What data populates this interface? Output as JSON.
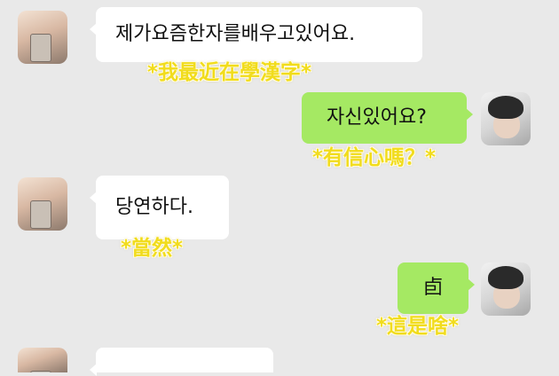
{
  "messages": [
    {
      "side": "in",
      "text": "제가요즘한자를배우고있어요.",
      "caption": "*我最近在學漢字*"
    },
    {
      "side": "out",
      "text": "자신있어요?",
      "caption": "*有信心嗎？*"
    },
    {
      "side": "in",
      "text": "당연하다.",
      "caption": "*當然*"
    },
    {
      "side": "out",
      "text": "卣",
      "caption": "*這是啥*"
    }
  ],
  "colors": {
    "background": "#e9e9e9",
    "incoming_bubble": "#ffffff",
    "outgoing_bubble": "#a5e963",
    "caption": "#f1dc1c"
  }
}
